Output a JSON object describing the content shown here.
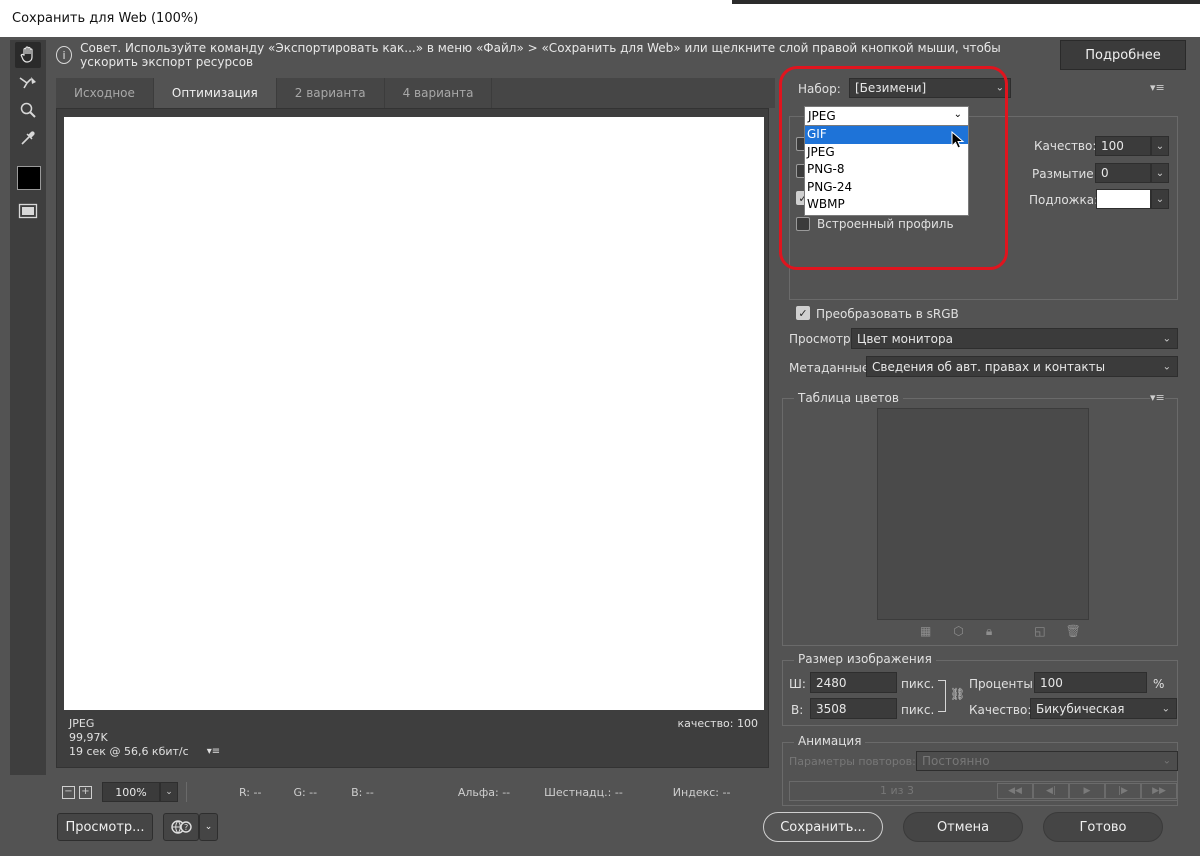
{
  "window": {
    "title": "Сохранить для Web (100%)"
  },
  "tip": {
    "text": "Совет. Используйте команду «Экспортировать как...» в меню «Файл» > «Сохранить для Web» или щелкните слой правой кнопкой мыши, чтобы ускорить экспорт ресурсов",
    "more_button": "Подробнее"
  },
  "tabs": [
    {
      "label": "Исходное",
      "active": false
    },
    {
      "label": "Оптимизация",
      "active": true
    },
    {
      "label": "2 варианта",
      "active": false
    },
    {
      "label": "4 варианта",
      "active": false
    }
  ],
  "canvas_info": {
    "format": "JPEG",
    "size": "99,97K",
    "time": "19 сек @ 56,6 кбит/с",
    "quality": "качество: 100"
  },
  "status": {
    "zoom": "100%",
    "r": "R: --",
    "g": "G: --",
    "b": "B: --",
    "alpha": "Альфа: --",
    "hex": "Шестнадц.: --",
    "index": "Индекс: --"
  },
  "buttons": {
    "preview": "Просмотр...",
    "save": "Сохранить...",
    "cancel": "Отмена",
    "done": "Готово"
  },
  "preset": {
    "label": "Набор:",
    "value": "[Безимени]"
  },
  "format_dropdown": {
    "current": "JPEG",
    "options": [
      "GIF",
      "JPEG",
      "PNG-8",
      "PNG-24",
      "WBMP"
    ],
    "highlighted": "GIF"
  },
  "settings": {
    "quality_label": "Качество:",
    "quality_value": "100",
    "blur_label": "Размытие:",
    "blur_value": "0",
    "matte_label": "Подложка:",
    "embedded_profile": "Встроенный профиль",
    "convert_srgb": "Преобразовать в sRGB",
    "preview_label": "Просмотр:",
    "preview_value": "Цвет монитора",
    "metadata_label": "Метаданные:",
    "metadata_value": "Сведения об авт. правах и контакты"
  },
  "color_table": {
    "title": "Таблица цветов"
  },
  "image_size": {
    "title": "Размер изображения",
    "w_label": "Ш:",
    "w_value": "2480",
    "h_label": "В:",
    "h_value": "3508",
    "unit": "пикс.",
    "percent_label": "Проценты:",
    "percent_value": "100",
    "percent_sign": "%",
    "quality_label": "Качество:",
    "quality_value": "Бикубическая"
  },
  "animation": {
    "title": "Анимация",
    "loop_label": "Параметры повторов:",
    "loop_value": "Постоянно",
    "frame_counter": "1 из 3"
  },
  "icons": [
    "hand-icon",
    "eyedropper-select-icon",
    "zoom-icon",
    "eyedropper-icon",
    "color-swatch-icon",
    "preview-toggle-icon",
    "info-icon",
    "menu-icon",
    "link-icon"
  ],
  "colors": {
    "accent_selection": "#1e73d8",
    "highlight_ring": "#e0141e",
    "panel_bg": "#535353"
  }
}
